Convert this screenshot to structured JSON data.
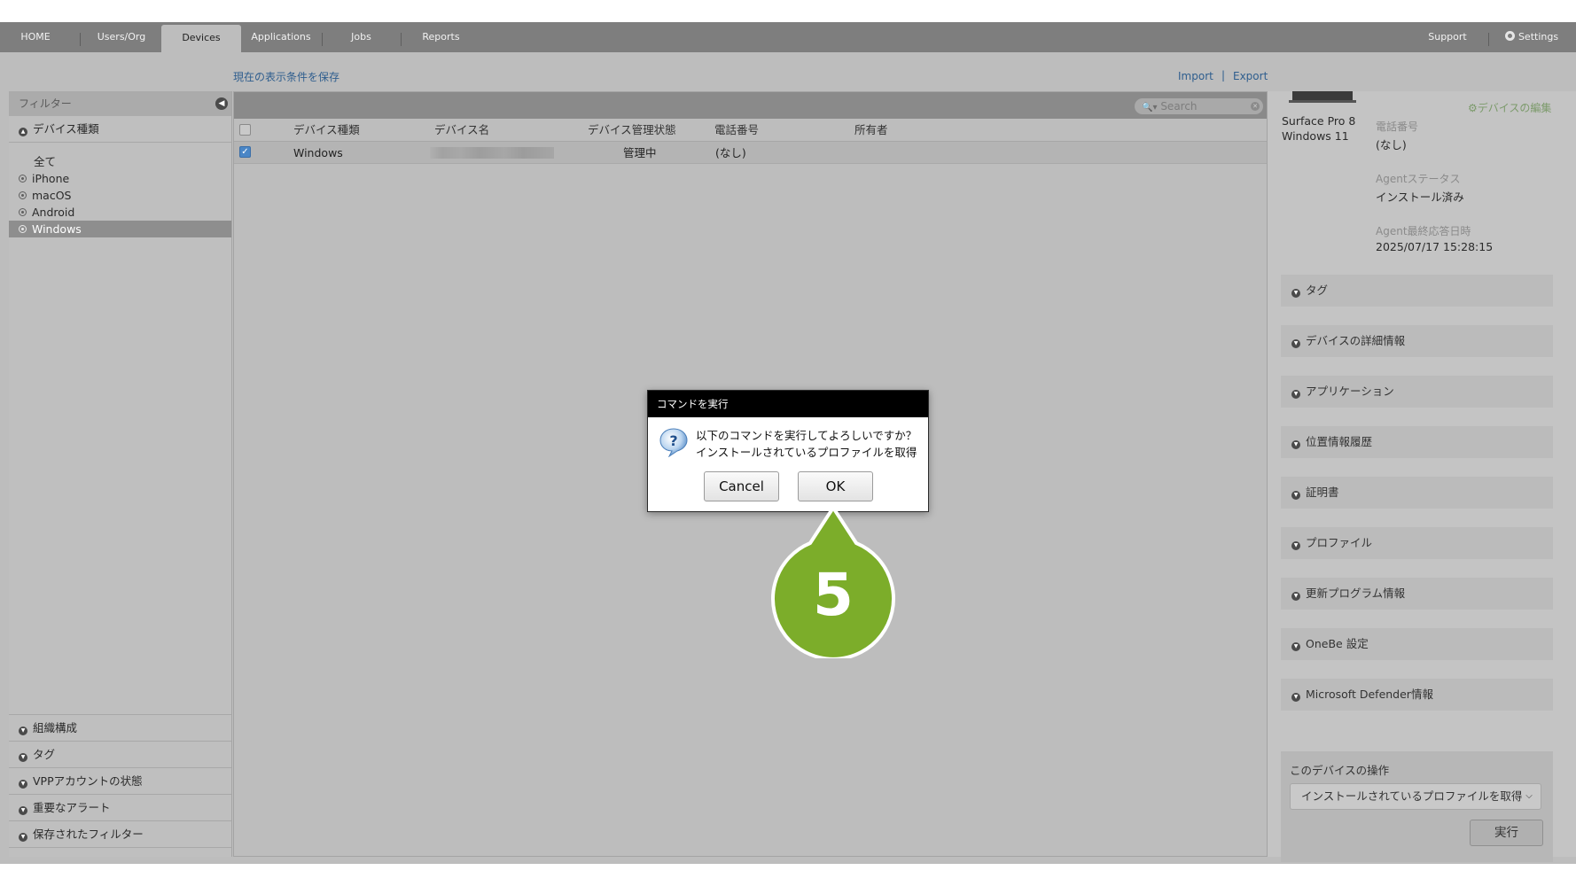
{
  "nav": {
    "tabs": [
      "HOME",
      "Users/Org",
      "Devices",
      "Applications",
      "Jobs",
      "Reports"
    ],
    "support": "Support",
    "settings": "Settings"
  },
  "toolbar": {
    "save_view": "現在の表示条件を保存",
    "import": "Import",
    "separator": "|",
    "export": "Export"
  },
  "sidebar": {
    "header": "フィルター",
    "device_type_section": "デバイス種類",
    "options": [
      "全て",
      "iPhone",
      "macOS",
      "Android",
      "Windows"
    ],
    "selected_option": "Windows",
    "bottom_sections": [
      "組織構成",
      "タグ",
      "VPPアカウントの状態",
      "重要なアラート",
      "保存されたフィルター"
    ]
  },
  "search": {
    "placeholder": "Search"
  },
  "table": {
    "columns": [
      "デバイス種類",
      "デバイス名",
      "デバイス管理状態",
      "電話番号",
      "所有者"
    ],
    "rows": [
      {
        "device_type": "Windows",
        "device_name": "",
        "status": "管理中",
        "phone": "(なし)",
        "owner": "",
        "checked": true
      }
    ]
  },
  "device_panel": {
    "model": "Surface Pro 8",
    "os": "Windows 11",
    "edit_link": "デバイスの編集",
    "phone_label": "電話番号",
    "phone_value": "(なし)",
    "agent_status_label": "Agentステータス",
    "agent_status_value": "インストール済み",
    "agent_last_label": "Agent最終応答日時",
    "agent_last_value": "2025/07/17 15:28:15",
    "accordions": [
      "タグ",
      "デバイスの詳細情報",
      "アプリケーション",
      "位置情報履歴",
      "証明書",
      "プロファイル",
      "更新プログラム情報",
      "OneBe 設定",
      "Microsoft Defender情報"
    ],
    "operations_title": "このデバイスの操作",
    "operation_selected": "インストールされているプロファイルを取得",
    "execute_button": "実行"
  },
  "dialog": {
    "title": "コマンドを実行",
    "message_line1": "以下のコマンドを実行してよろしいですか？",
    "message_line2": "インストールされているプロファイルを取得",
    "cancel": "Cancel",
    "ok": "OK"
  },
  "callout": {
    "step": "5",
    "color": "#7cad2a"
  }
}
